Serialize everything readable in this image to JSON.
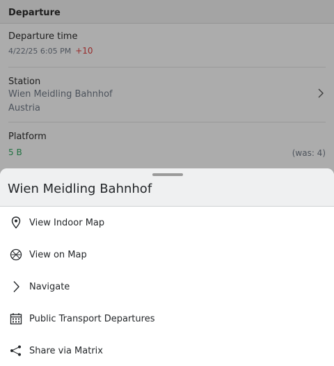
{
  "background": {
    "section_title": "Departure",
    "departure_time": {
      "label": "Departure time",
      "value": "4/22/25 6:05 PM",
      "delay": "+10"
    },
    "station": {
      "label": "Station",
      "name": "Wien Meidling Bahnhof",
      "country": "Austria"
    },
    "platform": {
      "label": "Platform",
      "value": "5 B",
      "previous": "(was: 4)"
    }
  },
  "sheet": {
    "title": "Wien Meidling Bahnhof",
    "items": [
      {
        "label": "View Indoor Map",
        "icon": "map-pin-icon"
      },
      {
        "label": "View on Map",
        "icon": "globe-icon"
      },
      {
        "label": "Navigate",
        "icon": "chevron-right-icon"
      },
      {
        "label": "Public Transport Departures",
        "icon": "calendar-icon"
      },
      {
        "label": "Share via Matrix",
        "icon": "share-icon"
      }
    ]
  },
  "colors": {
    "delay": "#d13b3b",
    "platform": "#2e9d5b",
    "text": "#232629"
  }
}
